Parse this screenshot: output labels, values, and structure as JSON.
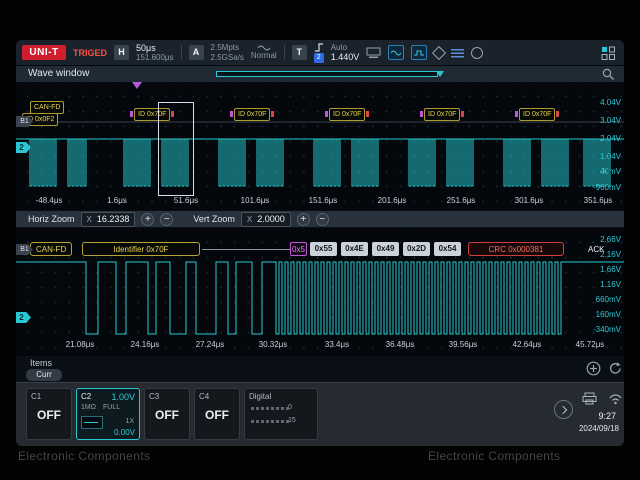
{
  "watermark": {
    "left": "Electronic Components",
    "right": "Electronic Components"
  },
  "toolbar": {
    "brand": "UNI-T",
    "trig_status": "TRIGED",
    "h_label": "H",
    "h_scale": "50μs",
    "h_position": "151.600μs",
    "a_label": "A",
    "mem_depth": "2.5Mpts",
    "sample_rate": "2.5GSa/s",
    "acq_mode": "Normal",
    "t_label": "T",
    "trig_source": "2",
    "trig_mode": "Auto",
    "trig_level": "1.440V"
  },
  "wave_window": {
    "title": "Wave window"
  },
  "upper_plot": {
    "bus_badge": "B1",
    "channel_badge": "2",
    "bus_type": "CAN-FD",
    "first_frame_id": "ID 0x0F2",
    "frame_ids": [
      "ID 0x70F",
      "ID 0x70F",
      "ID 0x70F",
      "ID 0x70F",
      "ID 0x70F"
    ],
    "time_labels": [
      "-48.4μs",
      "1.6μs",
      "51.6μs",
      "101.6μs",
      "151.6μs",
      "201.6μs",
      "251.6μs",
      "301.6μs",
      "351.6μs"
    ],
    "volt_labels": [
      "4.04V",
      "3.04V",
      "2.04V",
      "1.04V",
      "40mV",
      "-960mV"
    ]
  },
  "zoom_controls": {
    "horiz_label": "Horiz Zoom",
    "horiz_x": "X",
    "horiz_value": "16.2338",
    "vert_label": "Vert Zoom",
    "vert_x": "X",
    "vert_value": "2.0000",
    "plus": "+",
    "minus": "−"
  },
  "lower_plot": {
    "bus_badge": "B1",
    "channel_badge": "2",
    "bus_type": "CAN-FD",
    "identifier": "Identifier 0x70F",
    "dlc": "0x5",
    "data_bytes": [
      "0x55",
      "0x4E",
      "0x49",
      "0x2D",
      "0x54"
    ],
    "crc": "CRC 0x000381",
    "ack": "ACK",
    "time_labels": [
      "21.08μs",
      "24.16μs",
      "27.24μs",
      "30.32μs",
      "33.4μs",
      "36.48μs",
      "39.56μs",
      "42.64μs",
      "45.72μs"
    ],
    "volt_labels": [
      "2.66V",
      "2.16V",
      "1.66V",
      "1.16V",
      "660mV",
      "160mV",
      "-340mV"
    ]
  },
  "side_tabs": {
    "items": "Items",
    "curr": "Curr"
  },
  "channels": {
    "c1": {
      "name": "C1",
      "status": "OFF"
    },
    "c2": {
      "name": "C2",
      "scale": "1.00V",
      "impedance": "1MΩ",
      "bandwidth": "FULL",
      "probe": "1X",
      "offset": "0.00V"
    },
    "c3": {
      "name": "C3",
      "status": "OFF"
    },
    "c4": {
      "name": "C4",
      "status": "OFF"
    },
    "digital": {
      "name": "Digital",
      "first_bit": "0",
      "last_bit": "15"
    }
  },
  "system": {
    "clock": "9:27",
    "date": "2024/09/18"
  }
}
